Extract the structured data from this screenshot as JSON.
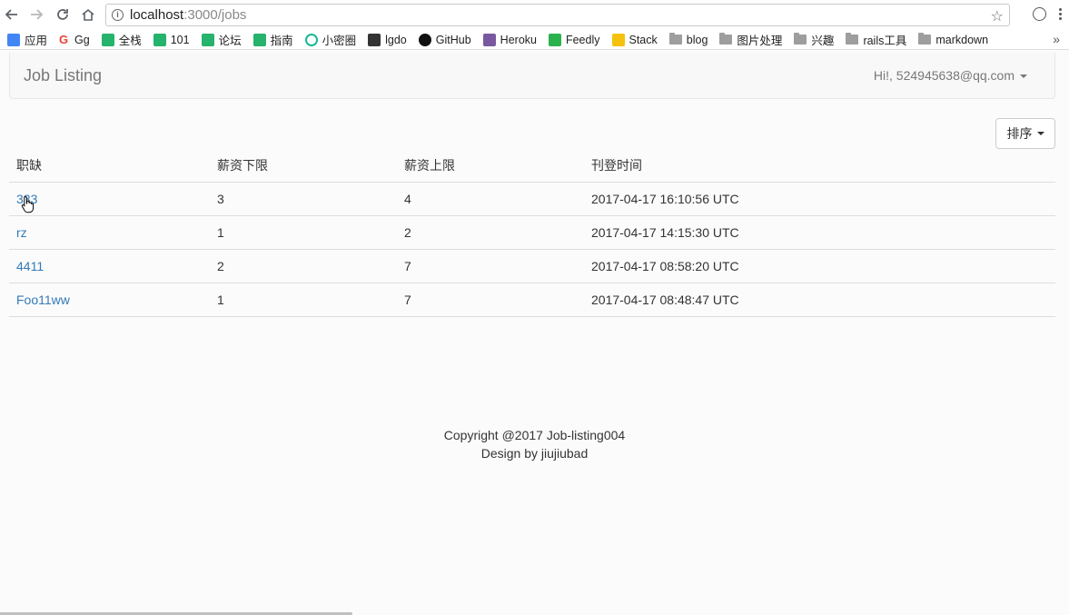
{
  "browser": {
    "url_host": "localhost",
    "url_path": ":3000/jobs",
    "bookmarks": [
      {
        "label": "应用",
        "icon": "apps-grid-icon",
        "color": "#4285f4"
      },
      {
        "label": "Gg",
        "icon": "google-icon",
        "color": "#ea4335"
      },
      {
        "label": "全栈",
        "icon": "fullstack-icon",
        "color": "#26b36b"
      },
      {
        "label": "101",
        "icon": "fullstack-icon",
        "color": "#26b36b"
      },
      {
        "label": "论坛",
        "icon": "leaf-icon",
        "color": "#26b36b"
      },
      {
        "label": "指南",
        "icon": "leaf-icon",
        "color": "#26b36b"
      },
      {
        "label": "小密圈",
        "icon": "circle-icon",
        "color": "#16b998"
      },
      {
        "label": "lgdo",
        "icon": "lgdo-icon",
        "color": "#333333"
      },
      {
        "label": "GitHub",
        "icon": "github-icon",
        "color": "#111111"
      },
      {
        "label": "Heroku",
        "icon": "heroku-icon",
        "color": "#79589f"
      },
      {
        "label": "Feedly",
        "icon": "feedly-icon",
        "color": "#2bb24c"
      },
      {
        "label": "Stack",
        "icon": "stack-icon",
        "color": "#f4c20d"
      },
      {
        "label": "blog",
        "icon": "folder-icon",
        "color": "#9e9e9e"
      },
      {
        "label": "图片处理",
        "icon": "folder-icon",
        "color": "#9e9e9e"
      },
      {
        "label": "兴趣",
        "icon": "folder-icon",
        "color": "#9e9e9e"
      },
      {
        "label": "rails工具",
        "icon": "folder-icon",
        "color": "#9e9e9e"
      },
      {
        "label": "markdown",
        "icon": "folder-icon",
        "color": "#9e9e9e"
      }
    ],
    "more_label": "»"
  },
  "navbar": {
    "brand": "Job Listing",
    "user": "Hi!, 524945638@qq.com"
  },
  "sort_button": "排序",
  "table": {
    "headers": [
      "职缺",
      "薪资下限",
      "薪资上限",
      "刊登时间"
    ],
    "rows": [
      {
        "title": "333",
        "min": "3",
        "max": "4",
        "date": "2017-04-17 16:10:56 UTC"
      },
      {
        "title": "rz",
        "min": "1",
        "max": "2",
        "date": "2017-04-17 14:15:30 UTC"
      },
      {
        "title": "4411",
        "min": "2",
        "max": "7",
        "date": "2017-04-17 08:58:20 UTC"
      },
      {
        "title": "Foo11ww",
        "min": "1",
        "max": "7",
        "date": "2017-04-17 08:48:47 UTC"
      }
    ]
  },
  "footer": {
    "copyright": "Copyright @2017 Job-listing004",
    "design": "Design by jiujiubad"
  },
  "colors": {
    "link": "#337ab7",
    "brand_text": "#777777"
  }
}
